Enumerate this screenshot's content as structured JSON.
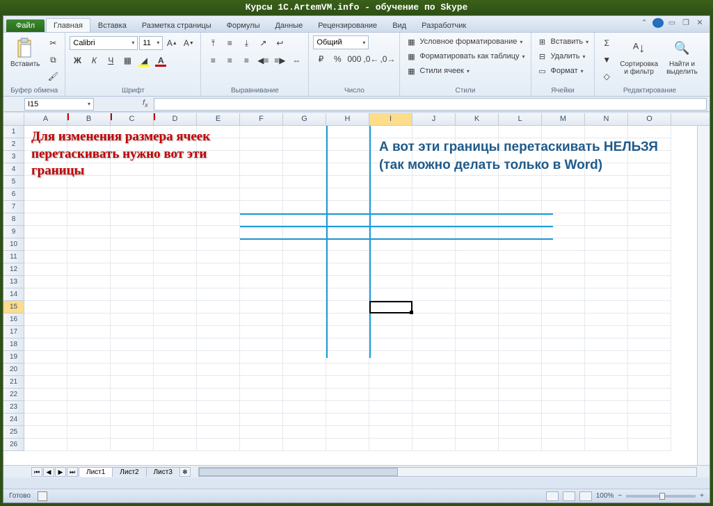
{
  "title": "Курсы 1C.ArtemVM.info - обучение по Skype",
  "tabs": {
    "file": "Файл",
    "items": [
      "Главная",
      "Вставка",
      "Разметка страницы",
      "Формулы",
      "Данные",
      "Рецензирование",
      "Вид",
      "Разработчик"
    ],
    "active": 0
  },
  "ribbon": {
    "clipboard": {
      "label": "Буфер обмена",
      "paste": "Вставить"
    },
    "font": {
      "label": "Шрифт",
      "name": "Calibri",
      "size": "11"
    },
    "alignment": {
      "label": "Выравнивание"
    },
    "number": {
      "label": "Число",
      "format": "Общий"
    },
    "styles": {
      "label": "Стили",
      "cond": "Условное форматирование",
      "table": "Форматировать как таблицу",
      "cell": "Стили ячеек"
    },
    "cells": {
      "label": "Ячейки",
      "insert": "Вставить",
      "delete": "Удалить",
      "format": "Формат"
    },
    "editing": {
      "label": "Редактирование",
      "sort": "Сортировка\nи фильтр",
      "find": "Найти и\nвыделить"
    }
  },
  "name_box": "I15",
  "columns": [
    "A",
    "B",
    "C",
    "D",
    "E",
    "F",
    "G",
    "H",
    "I",
    "J",
    "K",
    "L",
    "M",
    "N",
    "O"
  ],
  "row_count": 26,
  "selected_col": "I",
  "selected_row": 15,
  "annotations": {
    "red": "Для изменения размера ячеек перетаскивать нужно вот эти границы",
    "blue_l1": "А вот эти границы перетаскивать НЕЛЬЗЯ",
    "blue_l2": "(так можно делать только в Word)"
  },
  "sheets": [
    "Лист1",
    "Лист2",
    "Лист3"
  ],
  "status": {
    "ready": "Готово",
    "zoom": "100%"
  }
}
